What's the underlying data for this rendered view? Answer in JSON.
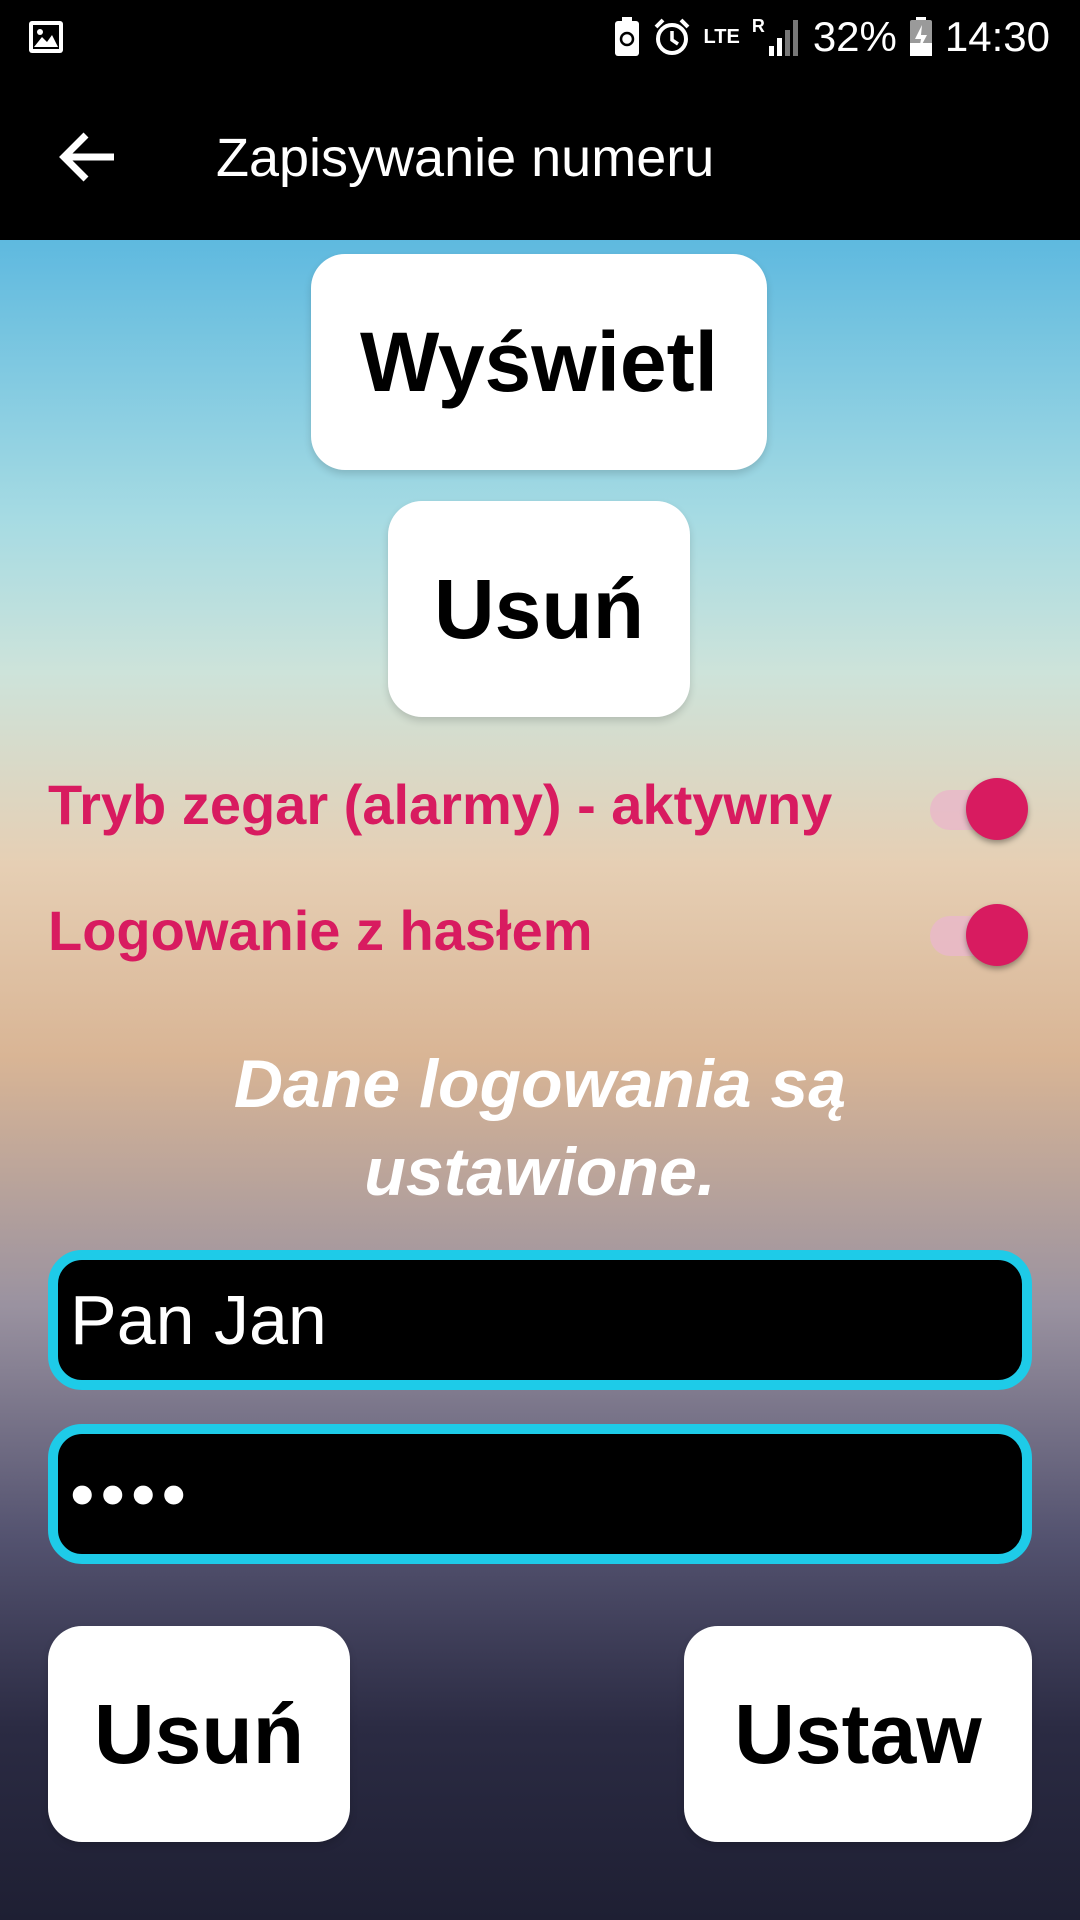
{
  "status_bar": {
    "battery": "32%",
    "time": "14:30",
    "network": "LTE",
    "roaming": "R",
    "icons": [
      "gallery-icon",
      "battery-saver-icon",
      "alarm-icon",
      "lte-icon",
      "signal-icon",
      "battery-charging-icon"
    ]
  },
  "app_bar": {
    "title": "Zapisywanie numeru",
    "back_icon": "arrow-back-icon"
  },
  "buttons": {
    "show": "Wyświetl",
    "delete_top": "Usuń",
    "delete_bottom": "Usuń",
    "set": "Ustaw"
  },
  "switches": [
    {
      "label": "Tryb zegar (alarmy) - aktywny",
      "checked": true
    },
    {
      "label": "Logowanie z hasłem",
      "checked": true
    }
  ],
  "login_status": "Dane logowania są ustawione.",
  "fields": {
    "username": "Pan Jan",
    "password": "••••"
  },
  "colors": {
    "accent": "#d81b60",
    "field_border": "#1ecbe8",
    "field_bg": "#000000",
    "bar_bg": "#000000"
  }
}
